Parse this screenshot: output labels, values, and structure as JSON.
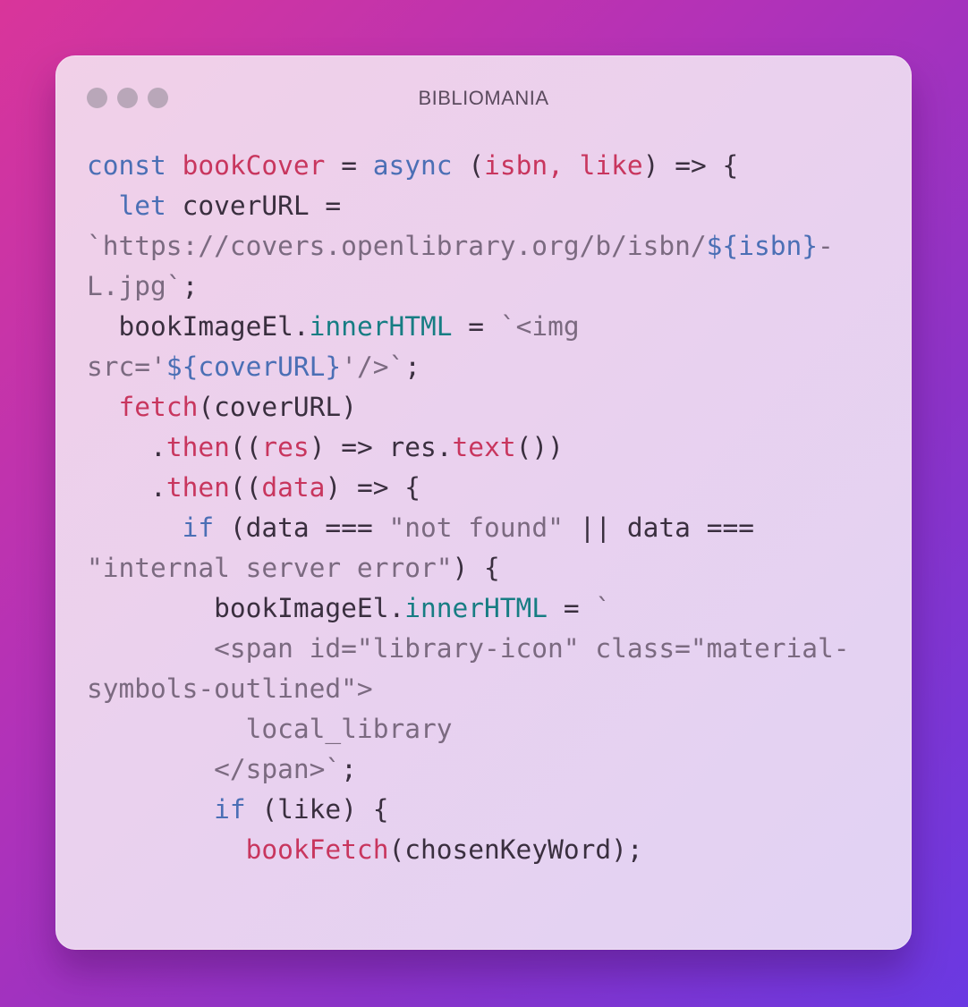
{
  "window": {
    "title": "BIBLIOMANIA",
    "controls": [
      "close",
      "minimize",
      "maximize"
    ]
  },
  "colors": {
    "keyword": "#4b6fb5",
    "function": "#c8365e",
    "string": "#7b6a80",
    "property": "#177d83",
    "plain": "#3a2f3f"
  },
  "code_lines": [
    [
      [
        "kw",
        "const "
      ],
      [
        "fn",
        "bookCover"
      ],
      [
        "pl",
        " = "
      ],
      [
        "kw",
        "async "
      ],
      [
        "pl",
        "("
      ],
      [
        "fn",
        "isbn, like"
      ],
      [
        "pl",
        ") => {"
      ]
    ],
    [
      [
        "pl",
        "  "
      ],
      [
        "kw",
        "let "
      ],
      [
        "pl",
        "coverURL ="
      ]
    ],
    [
      [
        "str",
        "`https://covers.openlibrary.org/b/isbn/"
      ],
      [
        "kw",
        "${isbn}"
      ],
      [
        "str",
        "-"
      ]
    ],
    [
      [
        "str",
        "L.jpg`"
      ],
      [
        "pl",
        ";"
      ]
    ],
    [
      [
        "pl",
        "  bookImageEl."
      ],
      [
        "prop",
        "innerHTML"
      ],
      [
        "pl",
        " = "
      ],
      [
        "str",
        "`<img"
      ]
    ],
    [
      [
        "str",
        "src='"
      ],
      [
        "kw",
        "${coverURL}"
      ],
      [
        "str",
        "'/>`"
      ],
      [
        "pl",
        ";"
      ]
    ],
    [
      [
        "pl",
        "  "
      ],
      [
        "fn",
        "fetch"
      ],
      [
        "pl",
        "(coverURL)"
      ]
    ],
    [
      [
        "pl",
        "    ."
      ],
      [
        "fn",
        "then"
      ],
      [
        "pl",
        "(("
      ],
      [
        "fn",
        "res"
      ],
      [
        "pl",
        ") => res."
      ],
      [
        "fn",
        "text"
      ],
      [
        "pl",
        "())"
      ]
    ],
    [
      [
        "pl",
        "    ."
      ],
      [
        "fn",
        "then"
      ],
      [
        "pl",
        "(("
      ],
      [
        "fn",
        "data"
      ],
      [
        "pl",
        ") => {"
      ]
    ],
    [
      [
        "pl",
        "      "
      ],
      [
        "kw",
        "if"
      ],
      [
        "pl",
        " (data === "
      ],
      [
        "str",
        "\"not found\""
      ],
      [
        "pl",
        " || data ==="
      ]
    ],
    [
      [
        "str",
        "\"internal server error\""
      ],
      [
        "pl",
        ") {"
      ]
    ],
    [
      [
        "pl",
        "        bookImageEl."
      ],
      [
        "prop",
        "innerHTML"
      ],
      [
        "pl",
        " = "
      ],
      [
        "str",
        "`"
      ]
    ],
    [
      [
        "str",
        "        <span id=\"library-icon\" class=\"material-"
      ]
    ],
    [
      [
        "str",
        "symbols-outlined\">"
      ]
    ],
    [
      [
        "str",
        "          local_library"
      ]
    ],
    [
      [
        "str",
        "        </span>`"
      ],
      [
        "pl",
        ";"
      ]
    ],
    [
      [
        "pl",
        "        "
      ],
      [
        "kw",
        "if"
      ],
      [
        "pl",
        " (like) {"
      ]
    ],
    [
      [
        "pl",
        "          "
      ],
      [
        "fn",
        "bookFetch"
      ],
      [
        "pl",
        "(chosenKeyWord);"
      ]
    ]
  ]
}
